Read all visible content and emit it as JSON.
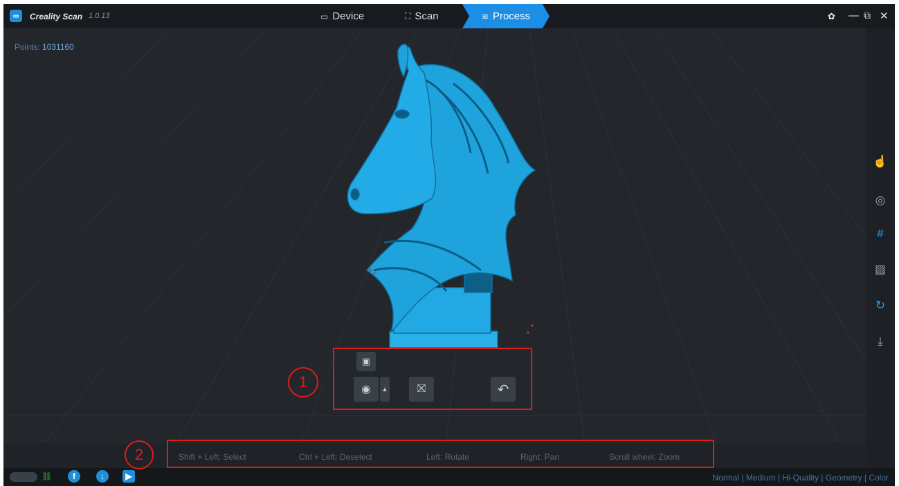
{
  "app": {
    "name": "Creality Scan",
    "version": "1.0.13",
    "logo_glyph": "∞"
  },
  "tabs": [
    {
      "label": "Device",
      "icon": "device-icon",
      "active": false
    },
    {
      "label": "Scan",
      "icon": "scan-icon",
      "active": false
    },
    {
      "label": "Process",
      "icon": "layers-icon",
      "active": true
    }
  ],
  "window_controls": {
    "settings": "✿",
    "minimize": "—",
    "restore": "⧉",
    "close": "✕"
  },
  "viewport": {
    "points_label": "Points:",
    "points_value": "1031160"
  },
  "annotations": {
    "circle_1": "1",
    "circle_2": "2"
  },
  "hints": [
    "Shift + Left:  Select",
    "Ctrl + Left:  Deselect",
    "Left:  Rotate",
    "Right:  Pan",
    "Scroll wheel:  Zoom"
  ],
  "quality_modes": "Normal | Medium | Hi-Quality | Geometry | Color",
  "colors": {
    "accent": "#1c8ee6",
    "model": "#1ea3dc",
    "annotation": "#e11a1a"
  },
  "right_tools": [
    "touch-icon",
    "rotate-lock-icon",
    "crop-icon",
    "image-icon",
    "refresh-icon",
    "download-icon"
  ]
}
